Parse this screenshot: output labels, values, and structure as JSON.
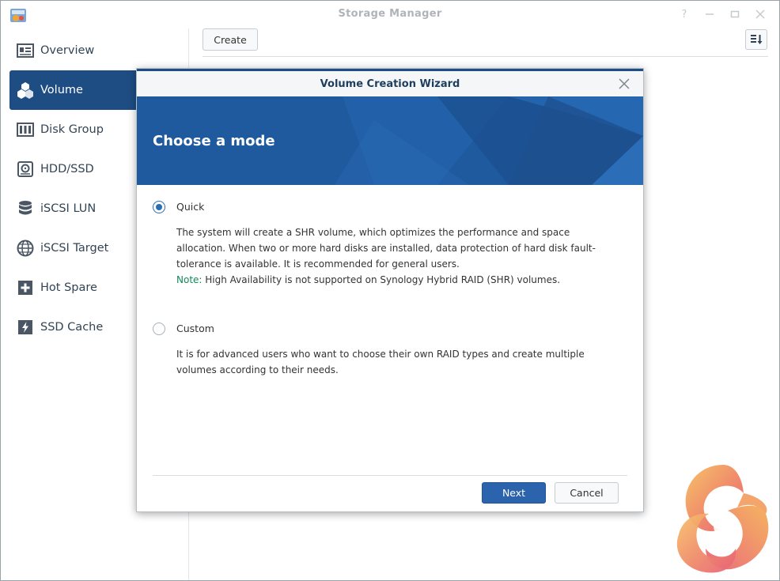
{
  "window": {
    "title": "Storage Manager",
    "controls": [
      "help-icon",
      "minimize-icon",
      "maximize-icon",
      "close-icon"
    ]
  },
  "sidebar": {
    "items": [
      {
        "label": "Overview",
        "icon": "overview-icon",
        "active": false
      },
      {
        "label": "Volume",
        "icon": "volume-icon",
        "active": true
      },
      {
        "label": "Disk Group",
        "icon": "disk-group-icon",
        "active": false
      },
      {
        "label": "HDD/SSD",
        "icon": "hdd-icon",
        "active": false
      },
      {
        "label": "iSCSI LUN",
        "icon": "iscsi-lun-icon",
        "active": false
      },
      {
        "label": "iSCSI Target",
        "icon": "iscsi-target-icon",
        "active": false
      },
      {
        "label": "Hot Spare",
        "icon": "hot-spare-icon",
        "active": false
      },
      {
        "label": "SSD Cache",
        "icon": "ssd-cache-icon",
        "active": false
      }
    ]
  },
  "toolbar": {
    "create_label": "Create",
    "sort_icon": "sort-icon"
  },
  "dialog": {
    "title": "Volume Creation Wizard",
    "banner_title": "Choose a mode",
    "options": [
      {
        "label": "Quick",
        "checked": true,
        "description": "The system will create a SHR volume, which optimizes the performance and space allocation. When two or more hard disks are installed, data protection of hard disk fault-tolerance is available. It is recommended for general users.",
        "note_label": "Note:",
        "note_text": " High Availability is not supported on Synology Hybrid RAID (SHR) volumes."
      },
      {
        "label": "Custom",
        "checked": false,
        "description": "It is for advanced users who want to choose their own RAID types and create multiple volumes according to their needs."
      }
    ],
    "next_label": "Next",
    "cancel_label": "Cancel"
  },
  "colors": {
    "accent": "#1e4d84",
    "banner": "#1f5a9e",
    "primary_button": "#2b64ad",
    "note": "#0f8a5a"
  }
}
